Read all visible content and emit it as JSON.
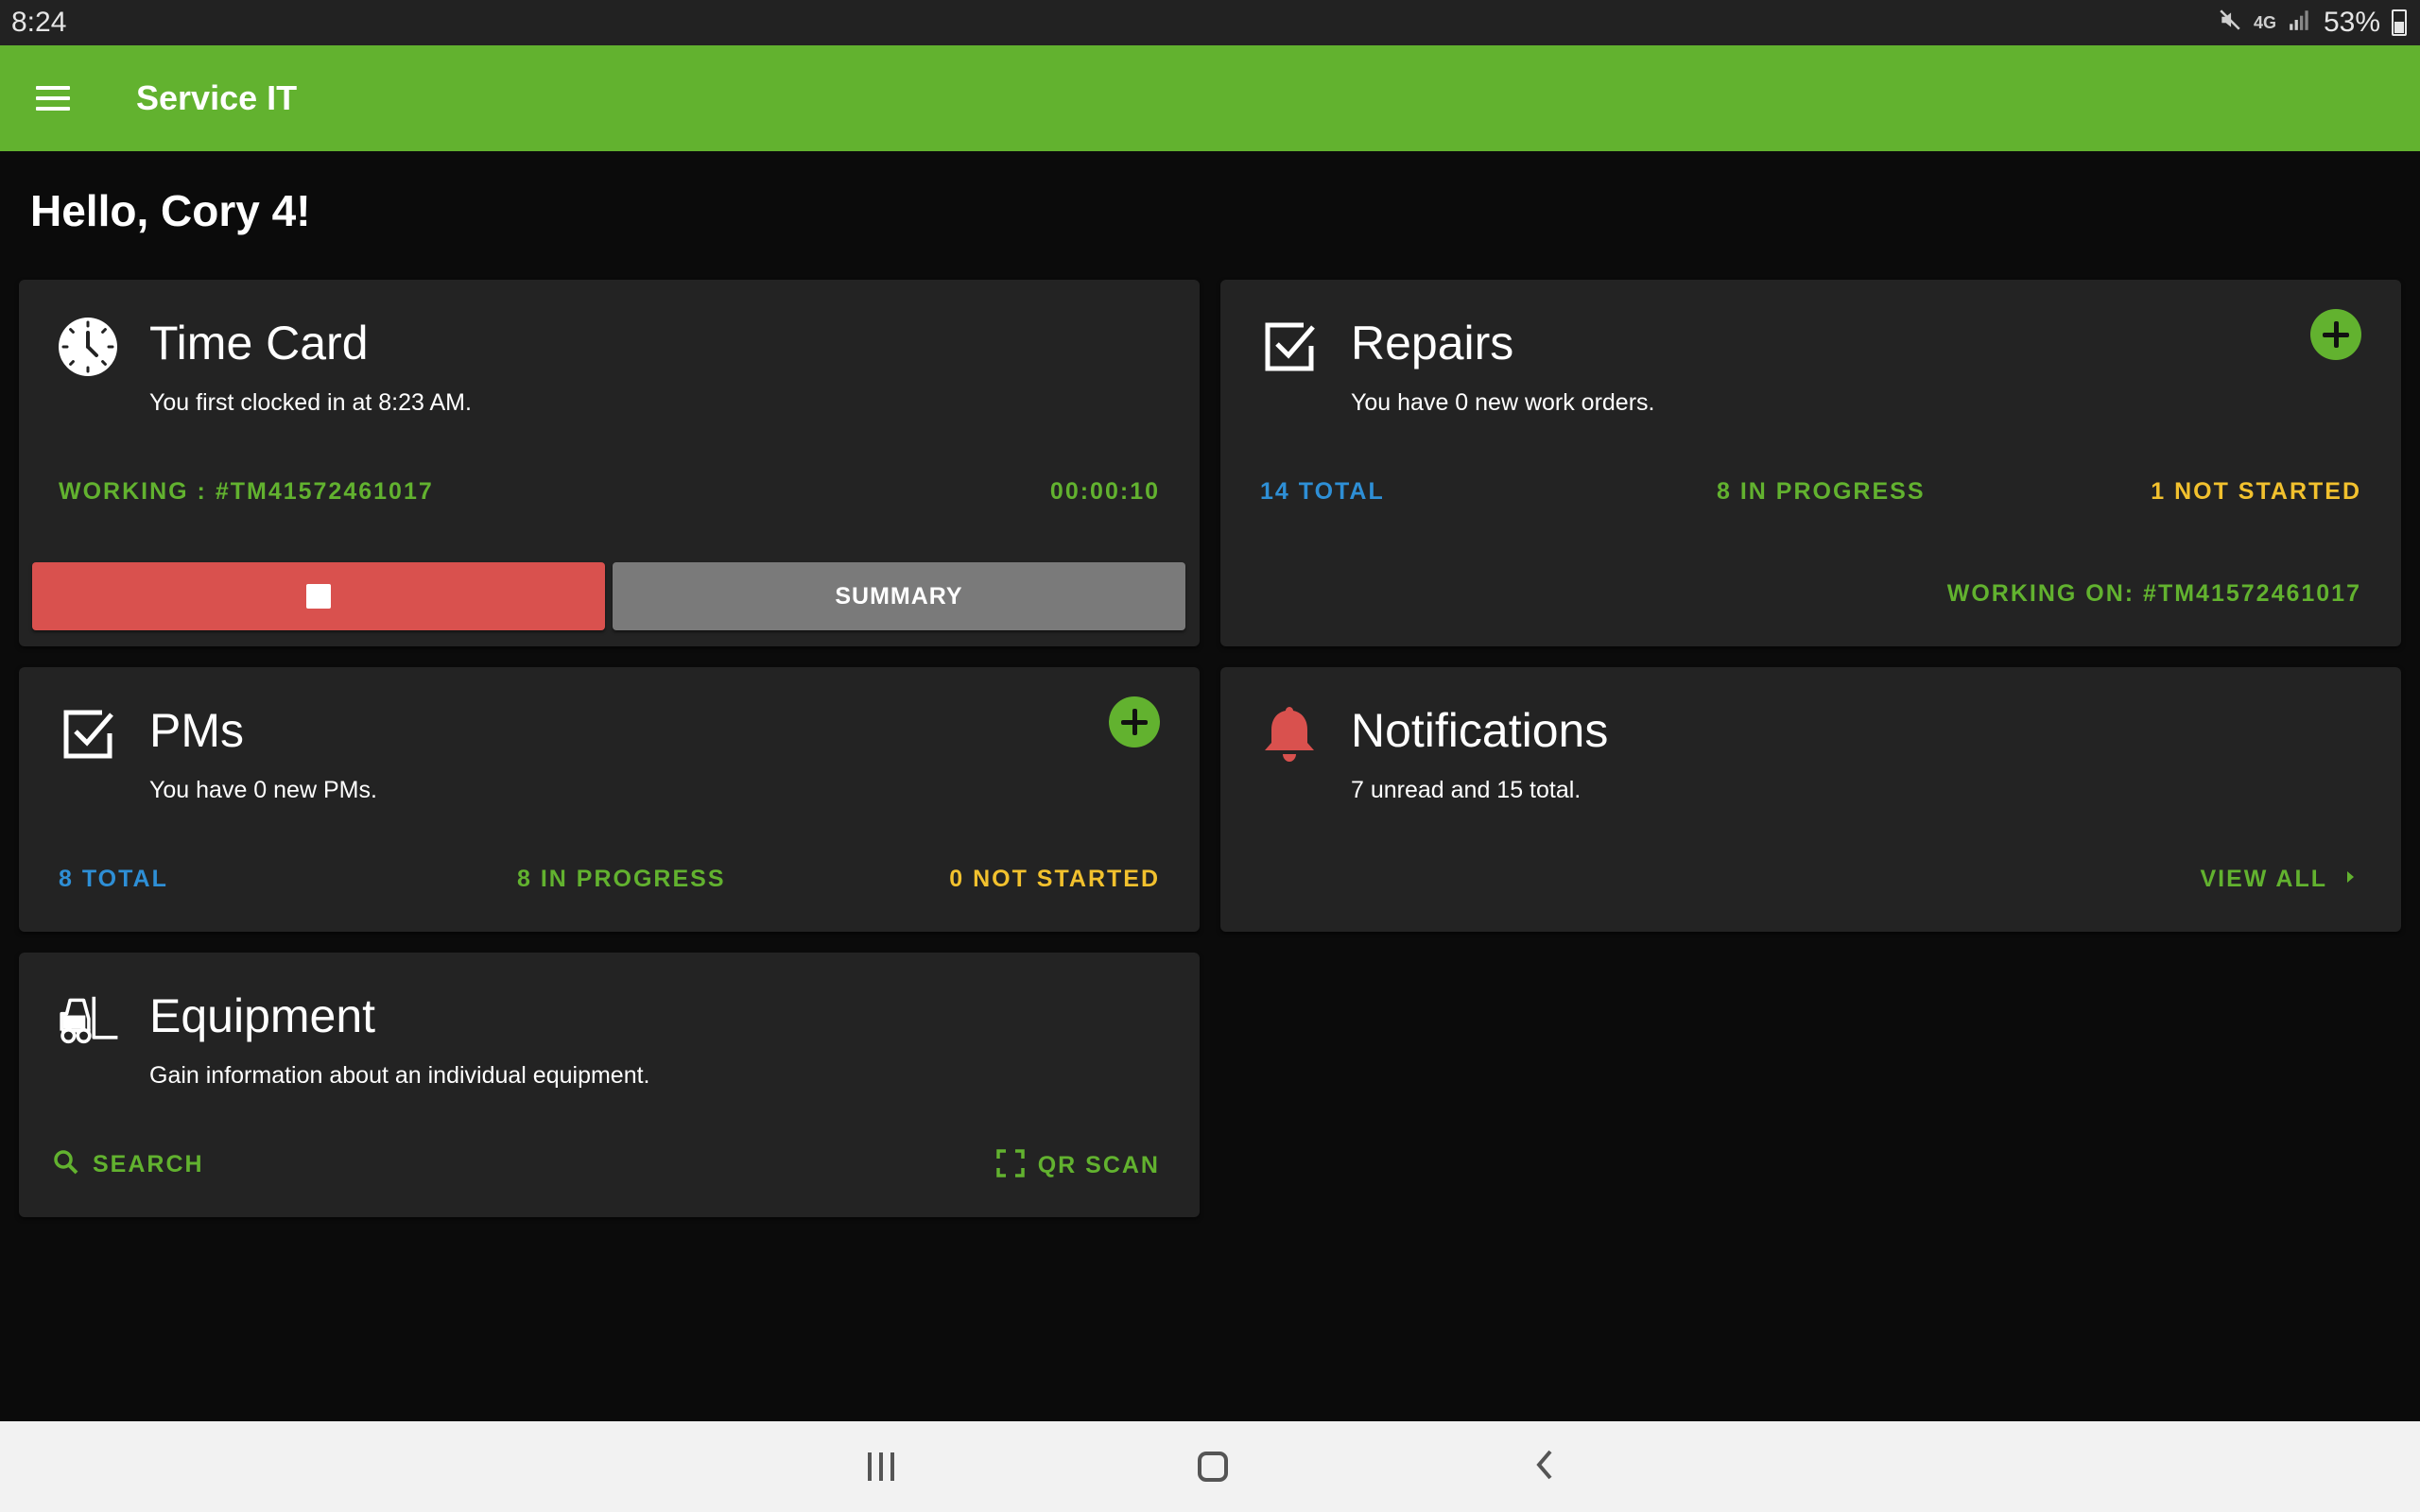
{
  "status_bar": {
    "time": "8:24",
    "network": "4G",
    "battery": "53%"
  },
  "app_bar": {
    "title": "Service IT"
  },
  "greeting": "Hello, Cory 4!",
  "time_card": {
    "title": "Time Card",
    "subtitle": "You first clocked in at 8:23 AM.",
    "working_label": "WORKING : #TM41572461017",
    "timer": "00:00:10",
    "summary_label": "SUMMARY"
  },
  "repairs": {
    "title": "Repairs",
    "subtitle": "You have 0 new work orders.",
    "total": "14 TOTAL",
    "in_progress": "8 IN PROGRESS",
    "not_started": "1 NOT STARTED",
    "working_on": "WORKING ON: #TM41572461017"
  },
  "pms": {
    "title": "PMs",
    "subtitle": "You have 0 new PMs.",
    "total": "8 TOTAL",
    "in_progress": "8 IN PROGRESS",
    "not_started": "0 NOT STARTED"
  },
  "notifications": {
    "title": "Notifications",
    "subtitle": "7 unread and 15 total.",
    "view_all": "VIEW ALL"
  },
  "equipment": {
    "title": "Equipment",
    "subtitle": "Gain information about an individual equipment.",
    "search_label": "SEARCH",
    "qr_label": "QR SCAN"
  },
  "colors": {
    "brand_green": "#62b22f",
    "blue": "#2e8fd6",
    "yellow": "#f2c12e",
    "red": "#d9514e"
  },
  "icons": {
    "time_card": "clock-icon",
    "repairs": "checkbox-icon",
    "pms": "checkbox-icon",
    "notifications": "bell-icon",
    "equipment": "forklift-icon"
  }
}
